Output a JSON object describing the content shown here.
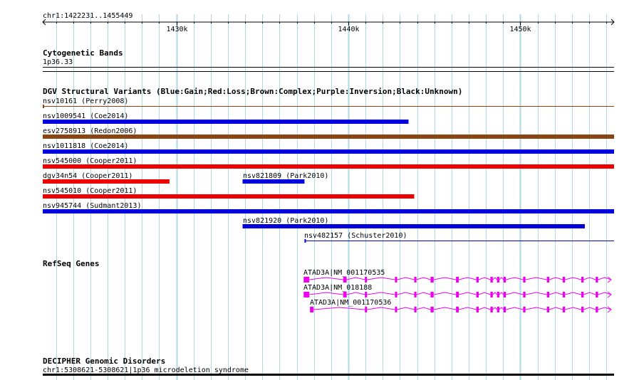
{
  "browser": {
    "location": "chr1:1422231..1455449",
    "view_start": 1422231,
    "view_end": 1455449,
    "grid_color": "#add8e6",
    "grid_minor_step_bp": 1000,
    "grid_major_step_bp": 10000
  },
  "ruler": {
    "ticks": [
      {
        "pos": 1430000,
        "label": "1430k"
      },
      {
        "pos": 1440000,
        "label": "1440k"
      },
      {
        "pos": 1450000,
        "label": "1450k"
      }
    ]
  },
  "tracks": {
    "cytoband": {
      "title": "Cytogenetic Bands",
      "band_label": "1p36.33"
    },
    "dgv": {
      "title": "DGV Structural Variants (Blue:Gain;Red:Loss;Brown:Complex;Purple:Inversion;Black:Unknown)",
      "colors": {
        "gain": "#0000dd",
        "loss": "#ee0000",
        "complex": "#8b4513",
        "unknown": "#000000"
      },
      "features": [
        {
          "label": "nsv10161 (Perry2008)",
          "start": 1422231,
          "end": 1455449,
          "type": "complex",
          "thin": true,
          "row": 0
        },
        {
          "label": "nsv1009541 (Coe2014)",
          "start": 1422231,
          "end": 1443500,
          "type": "gain",
          "row": 1
        },
        {
          "label": "esv2758913 (Redon2006)",
          "start": 1422231,
          "end": 1455449,
          "type": "complex",
          "row": 2
        },
        {
          "label": "nsv1011818 (Coe2014)",
          "start": 1422231,
          "end": 1455449,
          "type": "gain",
          "row": 3
        },
        {
          "label": "nsv545000 (Cooper2011)",
          "start": 1422231,
          "end": 1455449,
          "type": "loss",
          "row": 4
        },
        {
          "label": "dgv34n54 (Cooper2011)",
          "start": 1422231,
          "end": 1429600,
          "type": "loss",
          "row": 5
        },
        {
          "label": "nsv821809 (Park2010)",
          "start": 1433850,
          "end": 1437450,
          "type": "gain",
          "row": 5
        },
        {
          "label": "nsv545010 (Cooper2011)",
          "start": 1422231,
          "end": 1443830,
          "type": "loss",
          "row": 6
        },
        {
          "label": "nsv945744 (Sudmant2013)",
          "start": 1422231,
          "end": 1455449,
          "type": "gain",
          "row": 7
        },
        {
          "label": "nsv821920 (Park2010)",
          "start": 1433850,
          "end": 1453750,
          "type": "gain",
          "row": 8
        },
        {
          "label": "nsv482157 (Schuster2010)",
          "start": 1437450,
          "end": 1455449,
          "type": "gain",
          "thin": true,
          "row": 9
        }
      ]
    },
    "refseq": {
      "title": "RefSeq Genes",
      "color": "#ee00ee",
      "genes": [
        {
          "label": "ATAD3A|NM_001170535",
          "start": 1437400,
          "end": 1455449,
          "row": 0,
          "exons": [
            [
              1437400,
              1437730
            ],
            [
              1439700,
              1439900
            ],
            [
              1440960,
              1441080
            ],
            [
              1442710,
              1442830
            ],
            [
              1443830,
              1443960
            ],
            [
              1444780,
              1444960
            ],
            [
              1446260,
              1446420
            ],
            [
              1447440,
              1447580
            ],
            [
              1448260,
              1448400
            ],
            [
              1448640,
              1448780
            ],
            [
              1449020,
              1449160
            ],
            [
              1450160,
              1450300
            ],
            [
              1451540,
              1451680
            ],
            [
              1452460,
              1452600
            ],
            [
              1453540,
              1453680
            ],
            [
              1454380,
              1454520
            ]
          ]
        },
        {
          "label": "ATAD3A|NM_018188",
          "start": 1437400,
          "end": 1455449,
          "row": 1,
          "exons": [
            [
              1437400,
              1437730
            ],
            [
              1439700,
              1439900
            ],
            [
              1440960,
              1441080
            ],
            [
              1442710,
              1442830
            ],
            [
              1443830,
              1443960
            ],
            [
              1444780,
              1444960
            ],
            [
              1446260,
              1446420
            ],
            [
              1447440,
              1447580
            ],
            [
              1448260,
              1448400
            ],
            [
              1448640,
              1448780
            ],
            [
              1449020,
              1449160
            ],
            [
              1450160,
              1450300
            ],
            [
              1451540,
              1451680
            ],
            [
              1452460,
              1452600
            ],
            [
              1453540,
              1453680
            ],
            [
              1454380,
              1454520
            ]
          ]
        },
        {
          "label": "ATAD3A|NM_001170536",
          "start": 1437770,
          "end": 1455449,
          "row": 2,
          "exons": [
            [
              1437770,
              1437980
            ],
            [
              1440960,
              1441080
            ],
            [
              1442710,
              1442830
            ],
            [
              1443830,
              1443960
            ],
            [
              1444780,
              1444960
            ],
            [
              1446260,
              1446420
            ],
            [
              1447440,
              1447580
            ],
            [
              1448260,
              1448400
            ],
            [
              1448640,
              1448780
            ],
            [
              1449020,
              1449160
            ],
            [
              1450160,
              1450300
            ],
            [
              1451540,
              1451680
            ],
            [
              1452460,
              1452600
            ],
            [
              1453540,
              1453680
            ],
            [
              1454380,
              1454520
            ]
          ]
        }
      ]
    },
    "decipher": {
      "title": "DECIPHER Genomic Disorders",
      "feature_label": "chr1:5308621-5308621|1p36 microdeletion syndrome"
    }
  }
}
